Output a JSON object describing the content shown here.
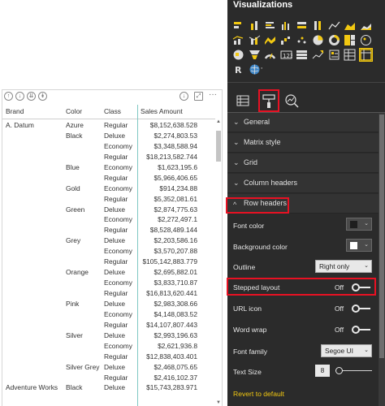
{
  "matrix": {
    "header": {
      "brand": "Brand",
      "color": "Color",
      "class": "Class",
      "amount": "Sales Amount"
    },
    "rows": [
      {
        "brand": "A. Datum",
        "color": "Azure",
        "class": "Regular",
        "amount": "$8,152,638.528"
      },
      {
        "brand": "",
        "color": "Black",
        "class": "Deluxe",
        "amount": "$2,274,803.53"
      },
      {
        "brand": "",
        "color": "",
        "class": "Economy",
        "amount": "$3,348,588.94"
      },
      {
        "brand": "",
        "color": "",
        "class": "Regular",
        "amount": "$18,213,582.744"
      },
      {
        "brand": "",
        "color": "Blue",
        "class": "Economy",
        "amount": "$1,623,195.6"
      },
      {
        "brand": "",
        "color": "",
        "class": "Regular",
        "amount": "$5,966,406.65"
      },
      {
        "brand": "",
        "color": "Gold",
        "class": "Economy",
        "amount": "$914,234.88"
      },
      {
        "brand": "",
        "color": "",
        "class": "Regular",
        "amount": "$5,352,081.61"
      },
      {
        "brand": "",
        "color": "Green",
        "class": "Deluxe",
        "amount": "$2,874,775.63"
      },
      {
        "brand": "",
        "color": "",
        "class": "Economy",
        "amount": "$2,272,497.1"
      },
      {
        "brand": "",
        "color": "",
        "class": "Regular",
        "amount": "$8,528,489.144"
      },
      {
        "brand": "",
        "color": "Grey",
        "class": "Deluxe",
        "amount": "$2,203,586.16"
      },
      {
        "brand": "",
        "color": "",
        "class": "Economy",
        "amount": "$3,570,207.88"
      },
      {
        "brand": "",
        "color": "",
        "class": "Regular",
        "amount": "$105,142,883.779"
      },
      {
        "brand": "",
        "color": "Orange",
        "class": "Deluxe",
        "amount": "$2,695,882.01"
      },
      {
        "brand": "",
        "color": "",
        "class": "Economy",
        "amount": "$3,833,710.87"
      },
      {
        "brand": "",
        "color": "",
        "class": "Regular",
        "amount": "$16,813,620.441"
      },
      {
        "brand": "",
        "color": "Pink",
        "class": "Deluxe",
        "amount": "$2,983,308.66"
      },
      {
        "brand": "",
        "color": "",
        "class": "Economy",
        "amount": "$4,148,083.52"
      },
      {
        "brand": "",
        "color": "",
        "class": "Regular",
        "amount": "$14,107,807.443"
      },
      {
        "brand": "",
        "color": "Silver",
        "class": "Deluxe",
        "amount": "$2,993,196.63"
      },
      {
        "brand": "",
        "color": "",
        "class": "Economy",
        "amount": "$2,621,936.8"
      },
      {
        "brand": "",
        "color": "",
        "class": "Regular",
        "amount": "$12,838,403.401"
      },
      {
        "brand": "",
        "color": "Silver Grey",
        "class": "Deluxe",
        "amount": "$2,468,075.65"
      },
      {
        "brand": "",
        "color": "",
        "class": "Regular",
        "amount": "$2,416,102.37"
      },
      {
        "brand": "Adventure Works",
        "color": "Black",
        "class": "Deluxe",
        "amount": "$15,743,283.971"
      }
    ]
  },
  "pane": {
    "title": "Visualizations",
    "more": "···",
    "sections": {
      "general": "General",
      "matrix_style": "Matrix style",
      "grid": "Grid",
      "column_headers": "Column headers",
      "row_headers": "Row headers"
    },
    "chevron_collapsed": "⌄",
    "chevron_expanded": "^",
    "props": {
      "font_color": "Font color",
      "background_color": "Background color",
      "outline": "Outline",
      "outline_value": "Right only",
      "stepped_layout": "Stepped layout",
      "stepped_state": "Off",
      "url_icon": "URL icon",
      "url_state": "Off",
      "word_wrap": "Word wrap",
      "wrap_state": "Off",
      "font_family": "Font family",
      "font_family_value": "Segoe UI",
      "text_size": "Text Size",
      "text_size_value": "8"
    },
    "revert": "Revert to default"
  },
  "colors": {
    "pane_bg": "#2b2b2b",
    "section_bg": "#333333",
    "highlight": "#e81123",
    "accent": "#f2c811",
    "teal": "#7fc8c3",
    "font_color_swatch": "#1e1e1e",
    "background_swatch": "#ffffff"
  },
  "icons": {
    "visual_header": [
      "pin-icon",
      "drill-up-icon",
      "drill-down-icon",
      "expand-icon",
      "down-arrow-icon",
      "focus-icon",
      "more-options-icon"
    ],
    "viz_gallery": [
      "stacked-bar-icon",
      "stacked-column-icon",
      "clustered-bar-icon",
      "clustered-column-icon",
      "100-bar-icon",
      "100-column-icon",
      "line-icon",
      "area-icon",
      "stacked-area-icon",
      "line-column-icon",
      "line-clustered-icon",
      "ribbon-icon",
      "waterfall-icon",
      "scatter-icon",
      "pie-icon",
      "donut-icon",
      "treemap-icon",
      "map-icon",
      "filled-map-icon",
      "funnel-icon",
      "gauge-icon",
      "card-icon",
      "multirow-card-icon",
      "kpi-icon",
      "slicer-icon",
      "table-icon",
      "matrix-icon",
      "r-visual-icon",
      "globe-icon"
    ],
    "tabs": [
      "fields-icon",
      "format-roller-icon",
      "analytics-icon"
    ]
  }
}
